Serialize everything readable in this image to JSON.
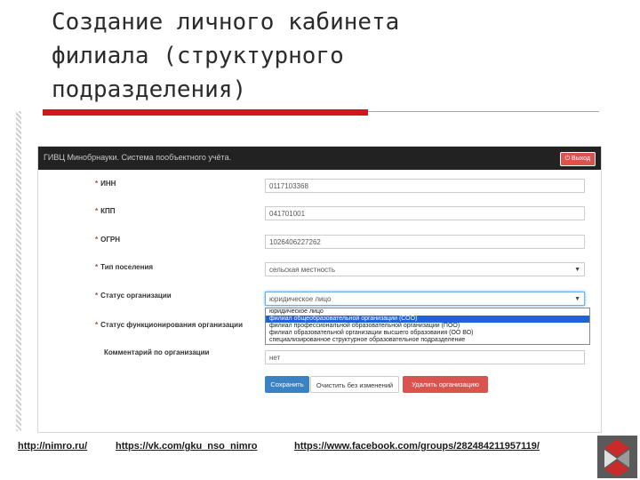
{
  "slide": {
    "title": "Создание личного кабинета\nфилиала (структурного\nподразделения)"
  },
  "app": {
    "brand": "ГИВЦ Минобрнауки.   Система пообъектного учёта.",
    "logout_label": "Выход"
  },
  "form": {
    "fields": [
      {
        "label": "ИНН",
        "value": "0117103368"
      },
      {
        "label": "КПП",
        "value": "041701001"
      },
      {
        "label": "ОГРН",
        "value": "1026406227262"
      },
      {
        "label": "Тип поселения",
        "value": "сельская местность"
      },
      {
        "label": "Статус организации",
        "value": "юридическое лицо"
      },
      {
        "label": "Статус функционирования организации",
        "value": ""
      },
      {
        "label": "Комментарий по организации",
        "value": "нет"
      }
    ],
    "status_options": [
      "юридическое лицо",
      "филиал общеобразовательной организации (СОО)",
      "филиал профессиональной образовательной организации (ПОО)",
      "филиал образовательной организации высшего образования (ОО ВО)",
      "специализированное структурное образовательное подразделение"
    ],
    "selected_option_index": 1,
    "buttons": {
      "save": "Сохранить",
      "clear": "Очистить без изменений",
      "delete": "Удалить организацию"
    }
  },
  "footer": {
    "links": [
      "http://nimro.ru/",
      "https://vk.com/gku_nso_nimro",
      "https://www.facebook.com/groups/282484211957119/"
    ]
  }
}
